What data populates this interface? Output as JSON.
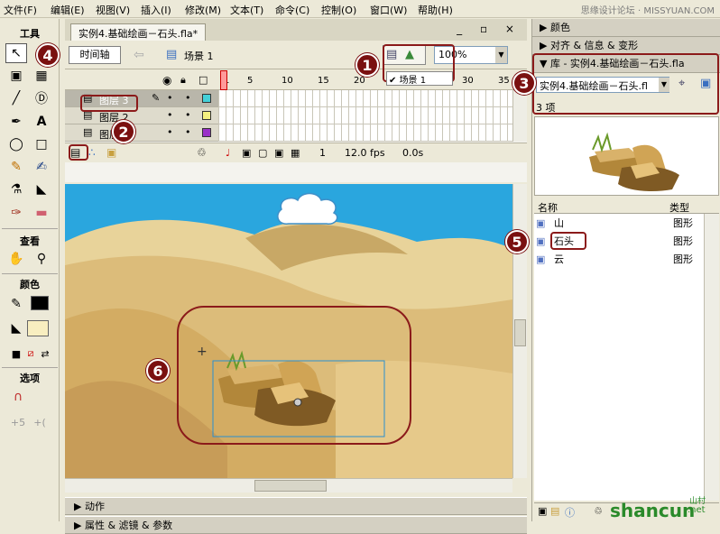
{
  "menu": [
    "文件(F)",
    "编辑(E)",
    "视图(V)",
    "插入(I)",
    "修改(M)",
    "文本(T)",
    "命令(C)",
    "控制(O)",
    "窗口(W)",
    "帮助(H)"
  ],
  "watermark": "思缘设计论坛 · MISSYUAN.COM",
  "tools": {
    "title": "工具",
    "view_label": "查看",
    "color_label": "颜色",
    "options_label": "选项"
  },
  "document": {
    "tab_title": "实例4.基础绘画－石头.fla*",
    "window_controls": "_ ▫ ×",
    "timeline_button": "时间轴",
    "scene_label": "场景 1",
    "zoom": "100%",
    "scene_menu_item": "场景 1"
  },
  "timeline": {
    "layers": [
      "图层 3",
      "图层 2",
      "图层 1"
    ],
    "frame_numbers": [
      "1",
      "5",
      "10",
      "15",
      "20",
      "25",
      "30",
      "35",
      "40"
    ],
    "current_frame": "1",
    "fps": "12.0 fps",
    "time": "0.0s"
  },
  "bottom_panels": {
    "actions": "动作",
    "properties": "属性 & 滤镜 & 参数"
  },
  "right_panel": {
    "color": "颜色",
    "align": "对齐 & 信息 & 变形",
    "library_title": "库 - 实例4.基础绘画－石头.fla",
    "library_select": "实例4.基础绘画－石头.fl",
    "item_count": "3 项",
    "col_name": "名称",
    "col_type": "类型",
    "items": [
      {
        "name": "山",
        "type": "图形"
      },
      {
        "name": "石头",
        "type": "图形"
      },
      {
        "name": "云",
        "type": "图形"
      }
    ]
  },
  "callouts": [
    "1",
    "2",
    "3",
    "4",
    "5",
    "6"
  ],
  "site_watermark": "shancun",
  "site_watermark_sub": ".net",
  "site_watermark_cn": "山村"
}
